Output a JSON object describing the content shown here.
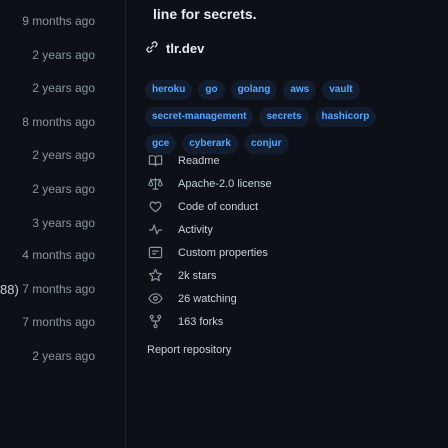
{
  "file_list": {
    "edge_fragment": "88)",
    "ages": [
      "9 months ago",
      "2 years ago",
      "2 years ago",
      "8 months ago",
      "2 years ago",
      "2 years ago",
      "3 years ago",
      "4 months ago",
      "7 months ago",
      "7 months ago",
      "2 years ago"
    ]
  },
  "about": {
    "description": "line for secrets.",
    "website": "tlr.dev",
    "topics": [
      [
        "heroku",
        "go",
        "golang",
        "aws",
        "vault"
      ],
      [
        "secret-management",
        "secrets",
        "hashicorp"
      ],
      [
        "gce",
        "cyberark",
        "conjur"
      ]
    ],
    "links": {
      "readme": "Readme",
      "license": "Apache-2.0 license",
      "conduct": "Code of conduct",
      "activity": "Activity",
      "custom_properties": "Custom properties",
      "stars": "2k stars",
      "watching": "26 watching",
      "forks": "163 forks"
    },
    "report": "Report repository"
  },
  "colors": {
    "background": "#0d1117",
    "topic_background": "#121d2f",
    "topic_text": "#58a6ff",
    "muted": "#8b949e"
  }
}
